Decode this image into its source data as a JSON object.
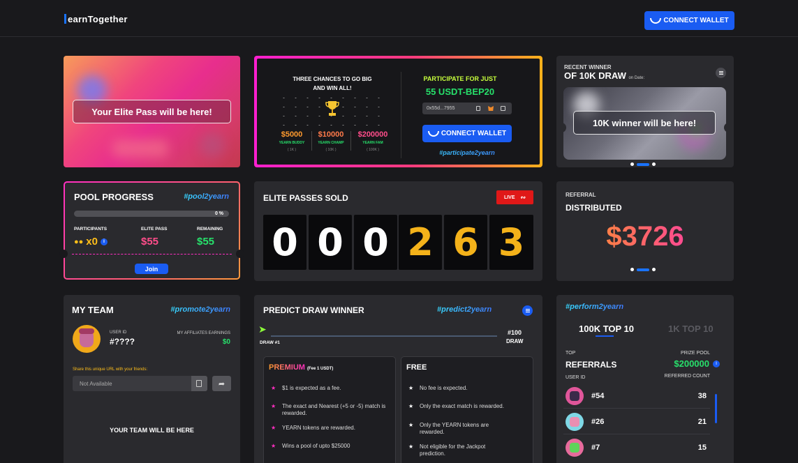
{
  "header": {
    "logo": "earnTogether",
    "connect_wallet": "CONNECT WALLET"
  },
  "elite_pass_card": {
    "label": "Your Elite Pass will be here!"
  },
  "chances": {
    "headline_1": "THREE CHANCES TO GO BIG",
    "headline_2": "AND WIN ALL!",
    "trophy_icon": "trophy-icon",
    "prizes": [
      {
        "amount": "$5000",
        "tier": "YEARN BUDDY",
        "pool": "( 1K )"
      },
      {
        "amount": "$10000",
        "tier": "YEARN CHAMP",
        "pool": "( 10K )"
      },
      {
        "amount": "$200000",
        "tier": "YEARN FAM",
        "pool": "( 100K )"
      }
    ],
    "participate_label": "PARTICIPATE FOR JUST",
    "price": "55 USDT-BEP20",
    "address": "0x55d...7955",
    "connect_wallet": "CONNECT WALLET",
    "hashtag": "#participate2yearn"
  },
  "recent_winner": {
    "top": "RECENT WINNER",
    "title": "OF 10K DRAW",
    "date_label": "on Date:",
    "slide_label": "10K winner will be here!"
  },
  "pool": {
    "title": "POOL PROGRESS",
    "hashtag": "#pool2yearn",
    "progress_text": "0 %",
    "progress": 0,
    "participants_label": "PARTICIPANTS",
    "participants_value": "x0",
    "elite_label": "ELITE PASS",
    "elite_value": "$55",
    "remaining_label": "REMAINING",
    "remaining_value": "$55",
    "join": "Join"
  },
  "sold": {
    "title": "ELITE PASSES SOLD",
    "live": "LIVE",
    "digits": [
      "0",
      "0",
      "0",
      "2",
      "6",
      "3"
    ]
  },
  "referral": {
    "top": "REFERRAL",
    "title": "DISTRIBUTED",
    "amount": "$3726"
  },
  "team": {
    "title": "MY TEAM",
    "hashtag": "#promote2yearn",
    "user_id_label": "USER ID",
    "user_id": "#????",
    "earnings_label": "MY AFFILIATES EARNINGS",
    "earnings": "$0",
    "share_label": "Share this unique URL with your friends:",
    "url_placeholder": "Not Available",
    "empty": "YOUR TEAM WILL BE HERE"
  },
  "predict": {
    "title": "PREDICT DRAW WINNER",
    "hashtag": "#predict2yearn",
    "draw_start": "DRAW #1",
    "draw_end_1": "#100",
    "draw_end_2": "DRAW",
    "premium": {
      "title": "PREMIUM",
      "fee": "(Fee 1 USDT)",
      "items": [
        "$1 is expected as a fee.",
        "The exact and Nearest (+5 or -5) match is rewarded.",
        "YEARN tokens are rewarded.",
        "Wins a pool of upto $25000"
      ]
    },
    "free": {
      "title": "FREE",
      "items": [
        "No fee is expected.",
        "Only the exact match is rewarded.",
        "Only the YEARN tokens are rewarded.",
        "Not eligible for the Jackpot prediction."
      ]
    }
  },
  "perform": {
    "hashtag": "#perform2yearn",
    "tabs": [
      "100K TOP 10",
      "1K TOP 10"
    ],
    "top_label": "TOP",
    "title": "REFERRALS",
    "prize_label": "PRIZE POOL",
    "prize": "$200000",
    "user_id_label": "USER ID",
    "count_label": "REFERRED COUNT",
    "rows": [
      {
        "id": "#54",
        "count": "38",
        "color": "#e0569a"
      },
      {
        "id": "#26",
        "count": "21",
        "color": "#7fd8e6"
      },
      {
        "id": "#7",
        "count": "15",
        "color": "#e76b9c"
      }
    ]
  },
  "colors": {
    "accent": "#1a5cf2",
    "green": "#27e06b",
    "pink": "#ff2ec2",
    "orange": "#ff9a2e"
  }
}
